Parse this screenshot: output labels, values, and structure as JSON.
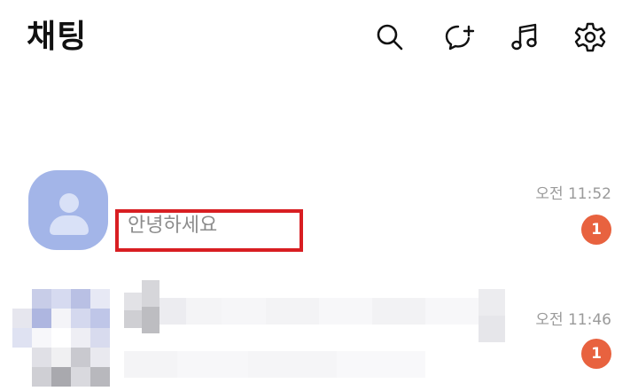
{
  "header": {
    "title": "채팅",
    "icons": [
      "search-icon",
      "new-chat-icon",
      "music-icon",
      "settings-icon"
    ]
  },
  "chats": [
    {
      "preview": "안녕하세요",
      "time": "오전 11:52",
      "unread": "1",
      "avatar_color": "#a3b5e8",
      "highlight_color": "#d81e22"
    },
    {
      "preview": "",
      "time": "오전 11:46",
      "unread": "1"
    }
  ],
  "colors": {
    "badge": "#e8623f",
    "time_text": "#9a9a9a",
    "preview_text": "#8c8c8c"
  }
}
